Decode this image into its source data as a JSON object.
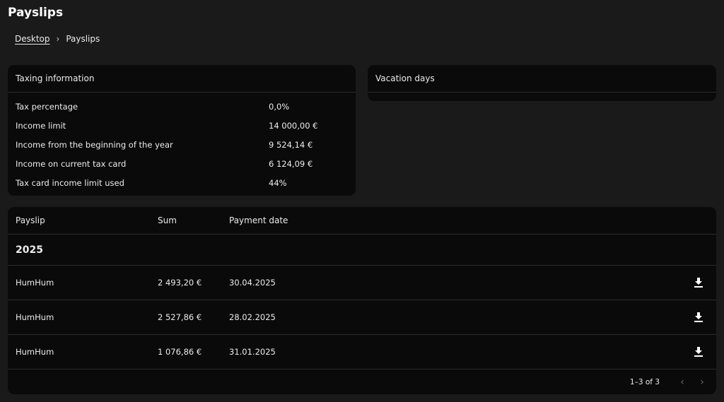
{
  "page": {
    "title": "Payslips"
  },
  "breadcrumb": {
    "home": "Desktop",
    "separator": "›",
    "current": "Payslips"
  },
  "taxing": {
    "title": "Taxing information",
    "rows": [
      {
        "label": "Tax percentage",
        "value": "0,0%"
      },
      {
        "label": "Income limit",
        "value": "14 000,00 €"
      },
      {
        "label": "Income from the beginning of the year",
        "value": "9 524,14 €"
      },
      {
        "label": "Income on current tax card",
        "value": "6 124,09 €"
      },
      {
        "label": "Tax card income limit used",
        "value": "44%"
      }
    ]
  },
  "vacation": {
    "title": "Vacation days"
  },
  "payslips": {
    "columns": {
      "name": "Payslip",
      "sum": "Sum",
      "date": "Payment date"
    },
    "group": "2025",
    "rows": [
      {
        "name": "HumHum",
        "sum": "2 493,20 €",
        "date": "30.04.2025"
      },
      {
        "name": "HumHum",
        "sum": "2 527,86 €",
        "date": "28.02.2025"
      },
      {
        "name": "HumHum",
        "sum": "1 076,86 €",
        "date": "31.01.2025"
      }
    ],
    "pagination": {
      "range": "1–3 of 3",
      "prev": "‹",
      "next": "›"
    }
  },
  "icons": {
    "download": "download-icon",
    "prev": "chevron-left-icon",
    "next": "chevron-right-icon"
  },
  "colors": {
    "background": "#1a1a1b",
    "card": "#0a0a0a",
    "divider": "#2c2c2e",
    "text": "#ececec",
    "disabled": "#6a6a6a"
  }
}
